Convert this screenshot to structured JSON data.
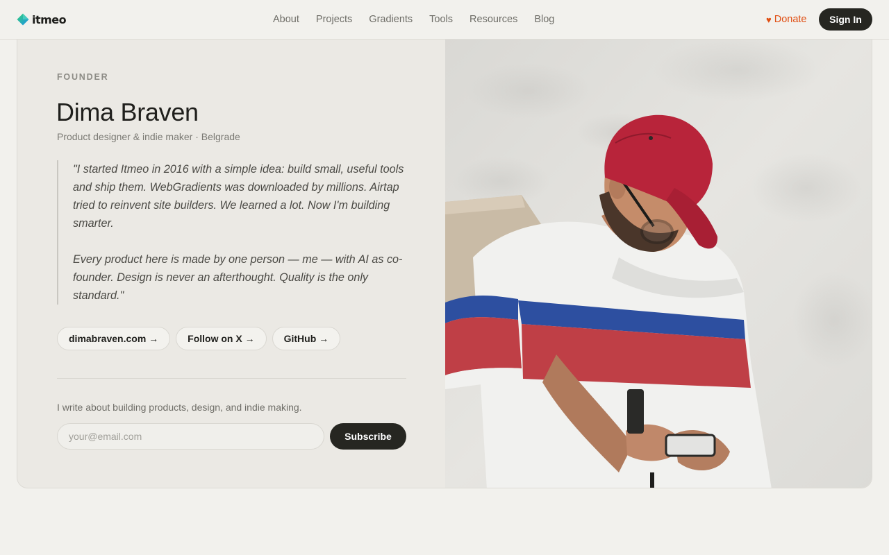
{
  "header": {
    "logo_text": "itmeo",
    "nav": [
      "About",
      "Projects",
      "Gradients",
      "Tools",
      "Resources",
      "Blog"
    ],
    "donate_label": "Donate",
    "donate_icon": "heart-icon",
    "signin_label": "Sign In"
  },
  "profile": {
    "eyebrow": "FOUNDER",
    "name": "Dima Braven",
    "role": "Product designer & indie maker · Belgrade",
    "quote": [
      "\"I started Itmeo in 2016 with a simple idea: build small, useful tools and ship them. WebGradients was downloaded by millions. Airtap tried to reinvent site builders. We learned a lot. Now I'm building smarter.",
      "Every product here is made by one person — me — with AI as co-founder. Design is never an afterthought. Quality is the only standard.\""
    ],
    "links": [
      "dimabraven.com →",
      "Follow on X →",
      "GitHub →"
    ]
  },
  "newsletter": {
    "text": "I write about building products, design, and indie making.",
    "placeholder": "your@email.com",
    "value": "",
    "subscribe_label": "Subscribe"
  },
  "colors": {
    "accent": "#e04e12",
    "button_dark": "#262621",
    "background": "#f2f1ed",
    "card": "#ebe9e4"
  }
}
